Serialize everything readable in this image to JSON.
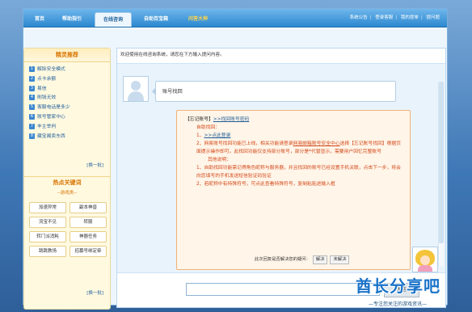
{
  "nav": {
    "tabs": [
      "首页",
      "帮助指引",
      "在线咨询",
      "自助百宝箱",
      "问答大神"
    ],
    "active_tab": 2,
    "right_links": [
      "系统公告",
      "登录客服",
      "我的提单",
      "提问题"
    ]
  },
  "sidebar": {
    "title": "精灵推荐",
    "items": [
      {
        "num": "1",
        "label": "解除安全模式"
      },
      {
        "num": "2",
        "label": "点卡余额"
      },
      {
        "num": "3",
        "label": "易信"
      },
      {
        "num": "4",
        "label": "刷钱无效"
      },
      {
        "num": "5",
        "label": "客服电话是多少"
      },
      {
        "num": "6",
        "label": "账号管家中心"
      },
      {
        "num": "7",
        "label": "丰主举判"
      },
      {
        "num": "8",
        "label": "藏宝阁卖东西"
      }
    ],
    "more": "[换一批]",
    "hot_title": "热点关键词",
    "hot_sub": "--游戏类--",
    "keywords": [
      "加速异常",
      "副本神兽",
      "流宝不见",
      "转服",
      "转门派消耗",
      "神器任务",
      "跳跳教场",
      "招募号绑定牵"
    ],
    "more2": "[换一批]"
  },
  "main": {
    "welcome": "欢迎使用在线咨询系统，请您在下方输入提问内容。",
    "user_message": "账号找回",
    "bot": {
      "line1_q": "【忘记账号】",
      "line1_link": ">>找回账号密码",
      "line2": "自助找回：",
      "line3_pre": "1、",
      "line3_link": ">>点此登录",
      "line4_a": "2、网易账号找回功能已上线，相关功能请登录",
      "line4_b": "网易邮箱账号安全中心",
      "line4_c": "选择【忘记账号找回】根据页面提示操作即可。此找回功能仅支持部分账号，部分是*代替显示，需要用户回忆完整账号",
      "line5": "其他说明：",
      "line6": "1、自助找回功能需记得角色昵称与服务器，并且找回的账号已经设置手机关联，点击下一步，将会向您填写的手机发送短信验证码验证",
      "line7": "2、若昵称中有特殊符号，可点此查看特殊符号，复制粘贴进输入框",
      "solved_q": "此次回复是否解决您的疑问：",
      "solved_btn": "解决",
      "unsolved_btn": "未解决"
    },
    "input_placeholder": "",
    "send_label": "发送"
  },
  "watermark": {
    "title": "酋长分享吧",
    "subtitle": "—专注您关注的游戏资讯—"
  },
  "colors": {
    "accent_blue": "#2c88cf",
    "orange_text": "#d2491a",
    "link_blue": "#1f5d99"
  }
}
